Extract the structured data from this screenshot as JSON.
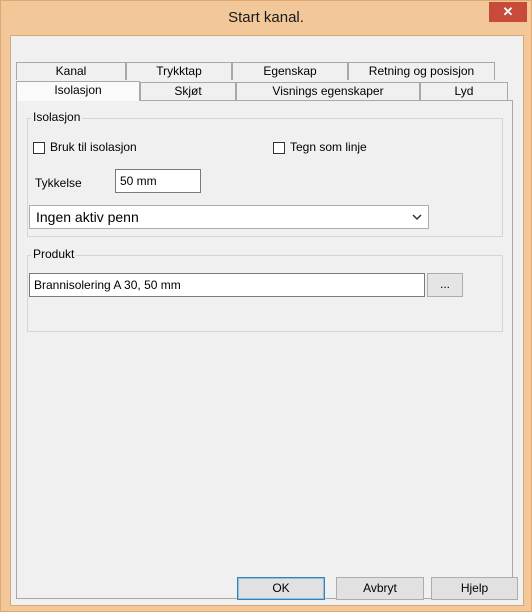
{
  "window": {
    "title": "Start kanal.",
    "close_glyph": "✕"
  },
  "tabs_row_top": [
    "Kanal",
    "Trykktap",
    "Egenskap",
    "Retning og posisjon"
  ],
  "tabs_row_bottom": [
    "Isolasjon",
    "Skjøt",
    "Visnings egenskaper",
    "Lyd"
  ],
  "isolasjon_group": {
    "title": "Isolasjon",
    "use_insulation_label": "Bruk til isolasjon",
    "draw_as_line_label": "Tegn som linje",
    "thickness_label": "Tykkelse",
    "thickness_value": "50 mm",
    "pen_selected": "Ingen aktiv penn",
    "pen_chevron_icon": "chevron-down-icon"
  },
  "produkt_group": {
    "title": "Produkt",
    "product_value": "Brannisolering  A 30, 50 mm",
    "browse_label": "..."
  },
  "buttons": {
    "ok": "OK",
    "cancel": "Avbryt",
    "help": "Hjelp"
  }
}
